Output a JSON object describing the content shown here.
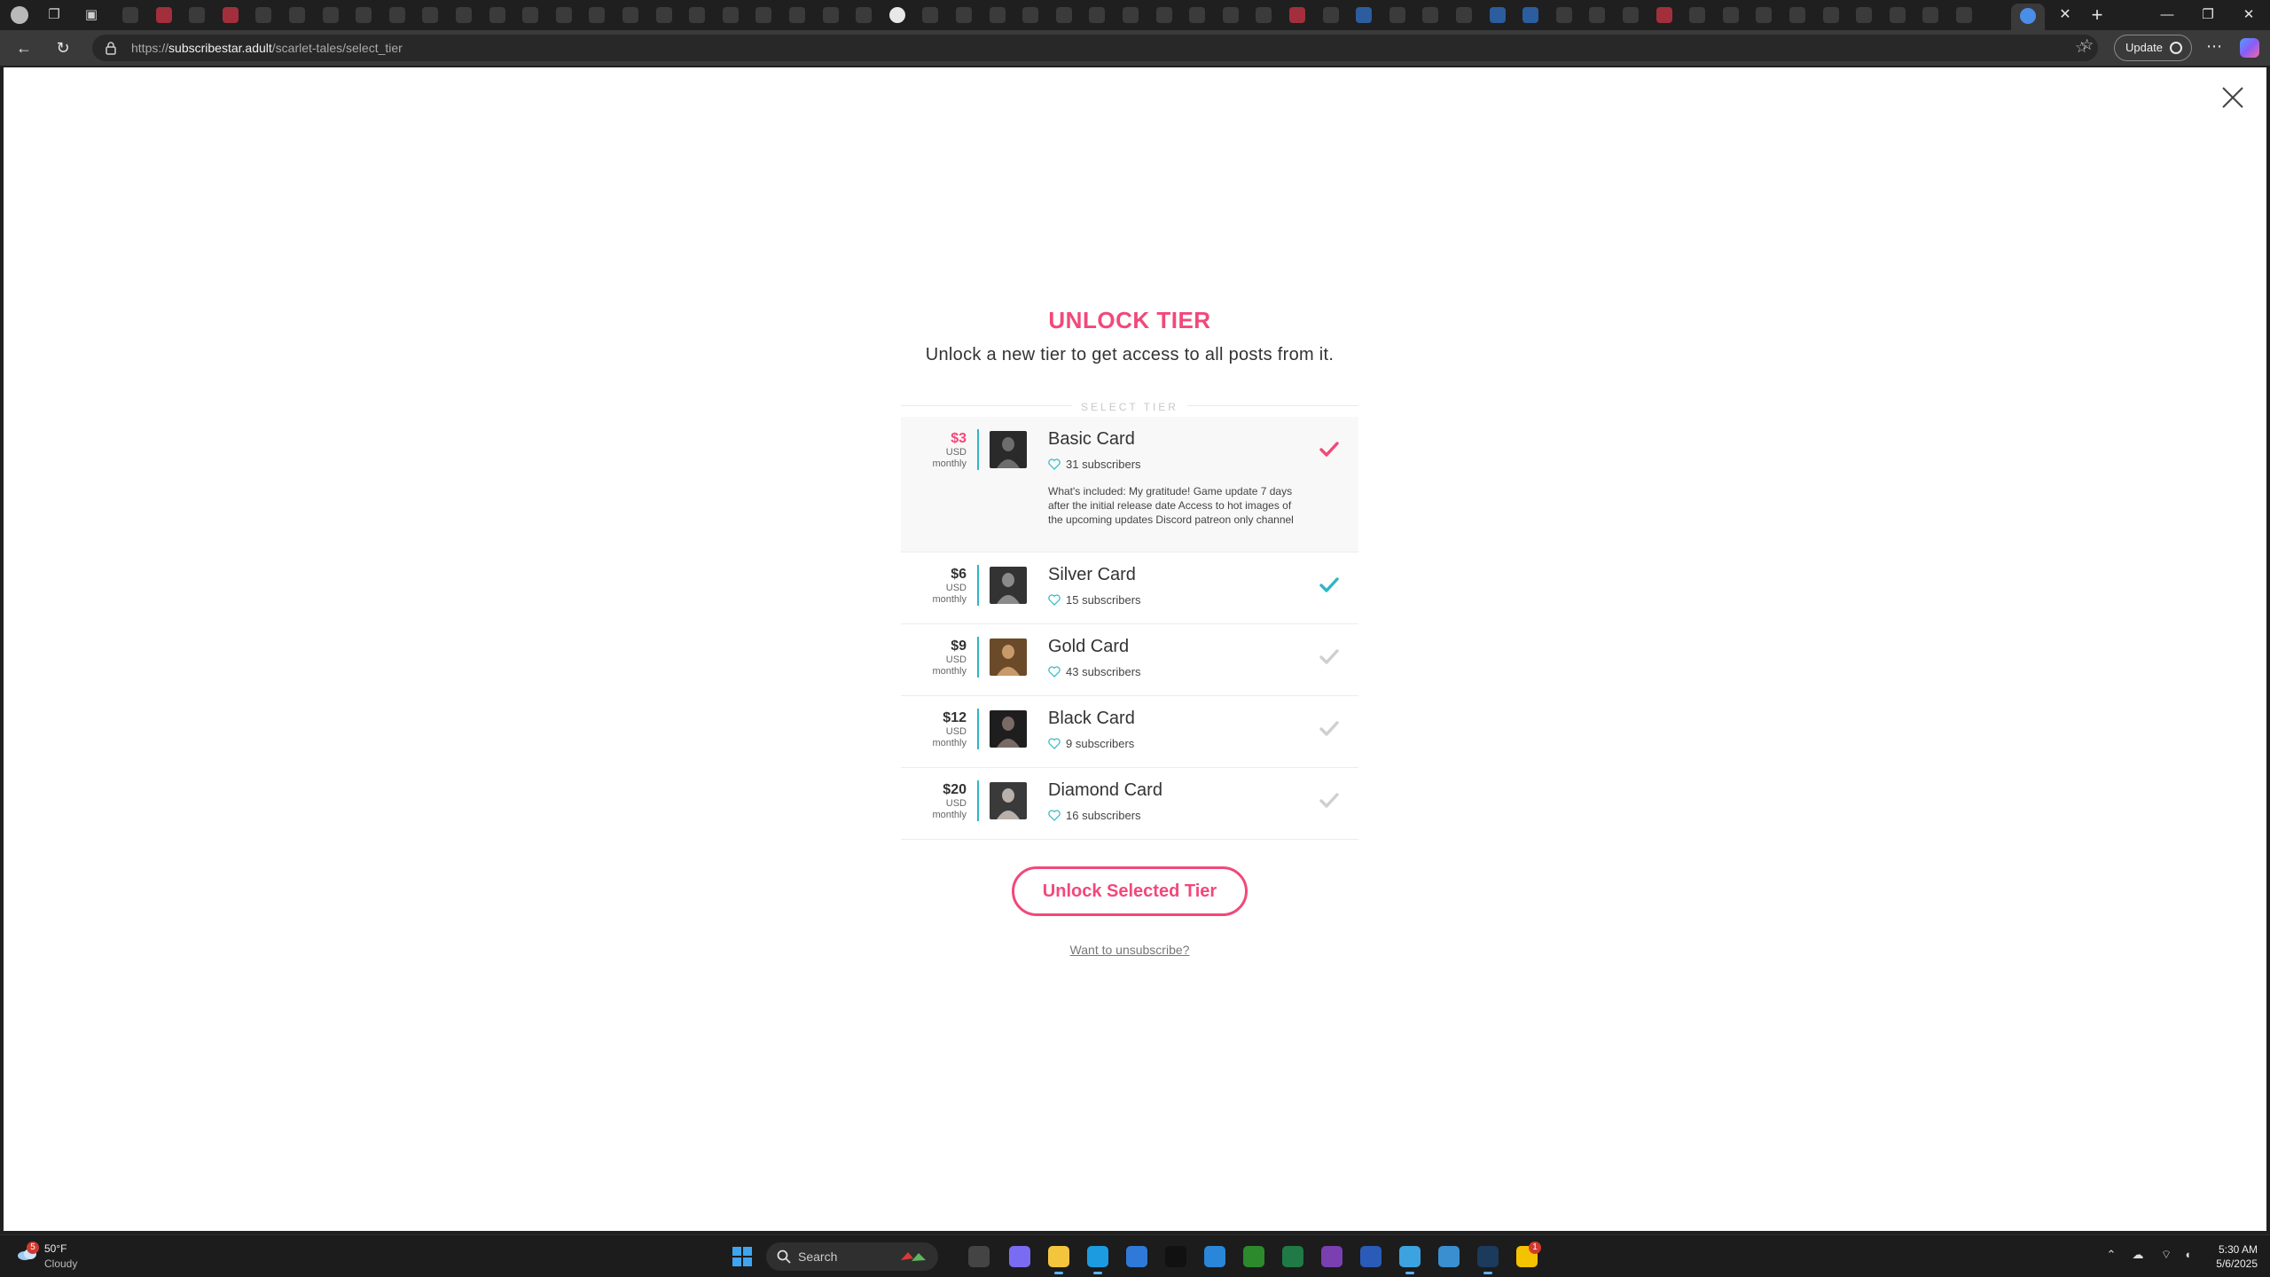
{
  "browser": {
    "url_scheme": "https://",
    "url_host": "subscribestar.adult",
    "url_path": "/scarlet-tales/select_tier",
    "update_label": "Update"
  },
  "modal": {
    "title": "UNLOCK TIER",
    "subtitle": "Unlock a new tier to get access to all posts from it.",
    "section_label": "SELECT TIER",
    "tiers": [
      {
        "price": "$3",
        "currency": "USD",
        "period": "monthly",
        "name": "Basic Card",
        "subscribers": "31 subscribers",
        "description": "What's included: My gratitude! Game update 7 days after the initial release date Access to hot images of the upcoming updates Discord patreon only channel",
        "selected": true,
        "check_color": "#f2487a"
      },
      {
        "price": "$6",
        "currency": "USD",
        "period": "monthly",
        "name": "Silver Card",
        "subscribers": "15 subscribers",
        "selected": false,
        "check_color": "#2fb6c4"
      },
      {
        "price": "$9",
        "currency": "USD",
        "period": "monthly",
        "name": "Gold Card",
        "subscribers": "43 subscribers",
        "selected": false,
        "check_color": "#cfcfcf"
      },
      {
        "price": "$12",
        "currency": "USD",
        "period": "monthly",
        "name": "Black Card",
        "subscribers": "9 subscribers",
        "selected": false,
        "check_color": "#cfcfcf"
      },
      {
        "price": "$20",
        "currency": "USD",
        "period": "monthly",
        "name": "Diamond Card",
        "subscribers": "16 subscribers",
        "selected": false,
        "check_color": "#cfcfcf"
      }
    ],
    "unlock_button": "Unlock Selected Tier",
    "unsubscribe_link": "Want to unsubscribe?"
  },
  "taskbar": {
    "weather_badge": "5",
    "weather_temp": "50°F",
    "weather_condition": "Cloudy",
    "search_label": "Search",
    "notification_badge": "1",
    "time": "5:30 AM",
    "date": "5/6/2025"
  },
  "colors": {
    "accent": "#f2487a",
    "teal": "#2fb6c4"
  }
}
